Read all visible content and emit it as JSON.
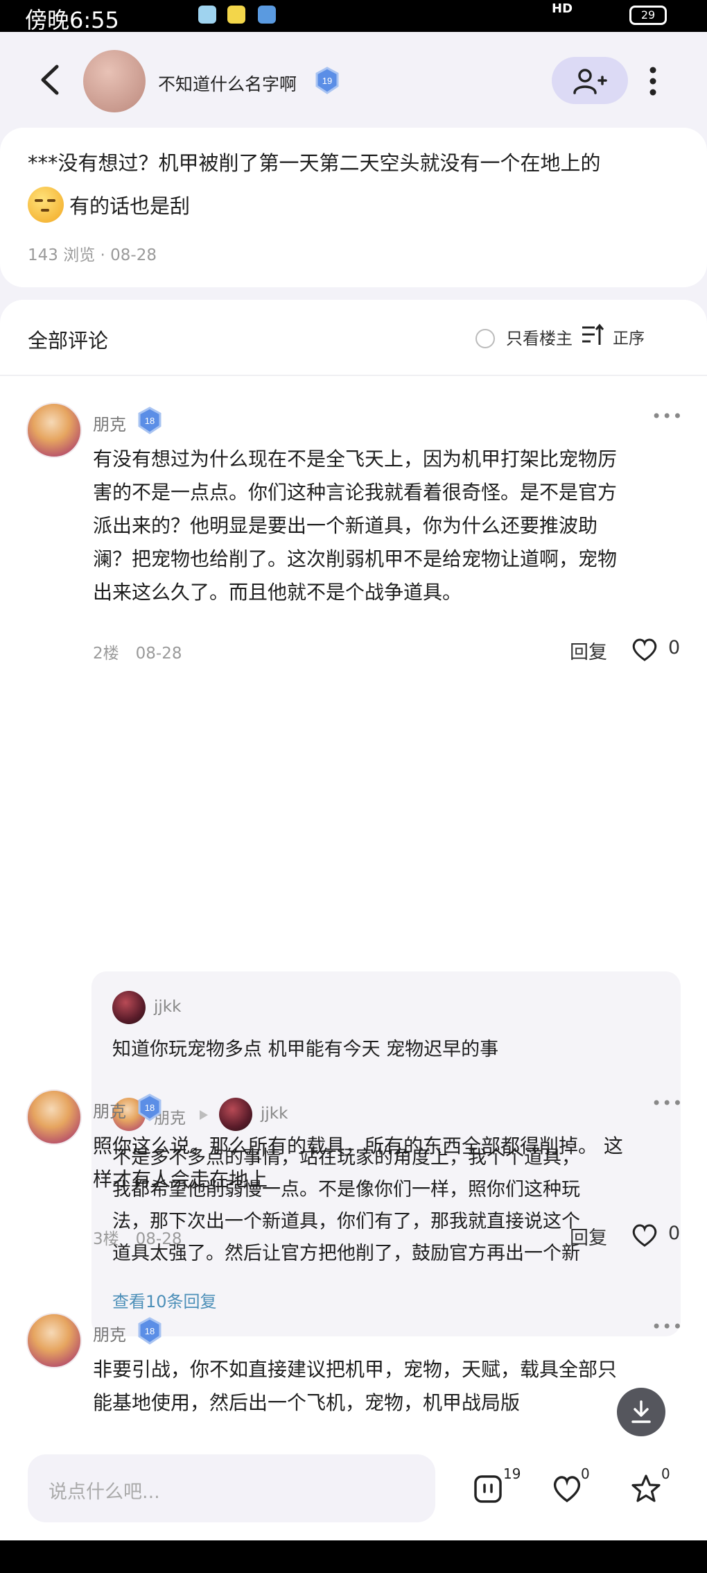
{
  "status_bar": {
    "time": "傍晚6:55",
    "network": "HD",
    "battery": "29"
  },
  "header": {
    "author_name": "不知道什么名字啊",
    "author_level": "19"
  },
  "post": {
    "text_line1": "***没有想过？机甲被削了第一天第二天空头就没有一个在地上的",
    "text_line2": "有的话也是刮",
    "views": "143 浏览",
    "date": "08-28"
  },
  "comments_header": {
    "title": "全部评论",
    "only_op": "只看楼主",
    "order": "正序"
  },
  "comments": [
    {
      "name": "朋克",
      "level": "18",
      "lines": [
        "有没有想过为什么现在不是全飞天上，因为机甲打架比宠物厉",
        "害的不是一点点。你们这种言论我就看着很奇怪。是不是官方",
        "派出来的？他明显是要出一个新道具，你为什么还要推波助",
        "澜？把宠物也给削了。这次削弱机甲不是给宠物让道啊，宠物",
        "出来这么久了。而且他就不是个战争道具。"
      ],
      "floor": "2楼",
      "date": "08-28",
      "reply": "回复",
      "likes": "0"
    },
    {
      "name": "朋克",
      "level": "18",
      "lines": [
        "照你这么说。那么所有的载具，所有的东西全部都得削掉。 这",
        "样才有人会走在地上"
      ],
      "floor": "3楼",
      "date": "08-28",
      "reply": "回复",
      "likes": "0"
    },
    {
      "name": "朋克",
      "level": "18",
      "lines": [
        "非要引战，你不如直接建议把机甲，宠物，天赋，载具全部只",
        "能基地使用，然后出一个飞机，宠物，机甲战局版"
      ]
    }
  ],
  "sub_replies": {
    "reply1": {
      "name": "jjkk",
      "text": "知道你玩宠物多点 机甲能有今天 宠物迟早的事"
    },
    "reply2": {
      "name": "朋克",
      "to": "jjkk",
      "lines": [
        "不是多不多点的事情，站在玩家的角度上，我个个道具，",
        "我都希望他削弱慢一点。不是像你们一样，照你们这种玩",
        "法，那下次出一个新道具，你们有了，那我就直接说这个",
        "道具太强了。然后让官方把他削了，鼓励官方再出一个新"
      ]
    },
    "view_more": "查看10条回复"
  },
  "bottom_bar": {
    "placeholder": "说点什么吧...",
    "comment_count": "19",
    "like_count": "0",
    "star_count": "0"
  },
  "colors": {
    "accent": "#4c8fb8",
    "follow_bg": "#dcdaf5",
    "level_badge": "#5b8ee6",
    "page_bg": "#f3f2f8"
  },
  "icons": [
    "back-arrow-icon",
    "level-badge-icon",
    "add-friend-icon",
    "more-vertical-icon",
    "radio-icon",
    "sort-icon",
    "more-horizontal-icon",
    "heart-icon",
    "play-triangle-icon",
    "download-icon",
    "comment-icon",
    "star-icon"
  ]
}
